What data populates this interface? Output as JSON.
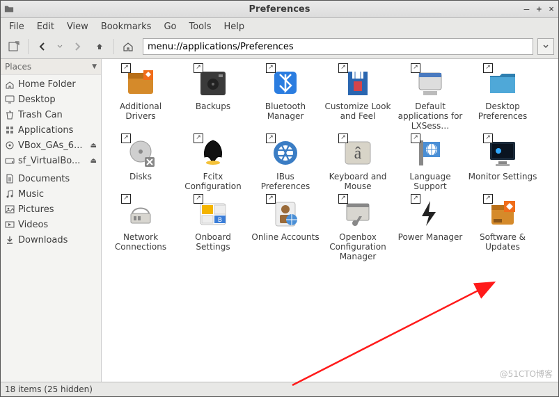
{
  "window": {
    "title": "Preferences"
  },
  "menus": [
    "File",
    "Edit",
    "View",
    "Bookmarks",
    "Go",
    "Tools",
    "Help"
  ],
  "addressbar": {
    "value": "menu://applications/Preferences"
  },
  "sidebar": {
    "header": "Places",
    "items": [
      {
        "icon": "home",
        "label": "Home Folder"
      },
      {
        "icon": "desktop",
        "label": "Desktop"
      },
      {
        "icon": "trash",
        "label": "Trash Can"
      },
      {
        "icon": "apps",
        "label": "Applications"
      },
      {
        "icon": "disc",
        "label": "VBox_GAs_6...",
        "ejectable": true
      },
      {
        "icon": "drive",
        "label": "sf_VirtualBo...",
        "ejectable": true
      }
    ],
    "bookmarks": [
      {
        "icon": "docs",
        "label": "Documents"
      },
      {
        "icon": "music",
        "label": "Music"
      },
      {
        "icon": "pictures",
        "label": "Pictures"
      },
      {
        "icon": "videos",
        "label": "Videos"
      },
      {
        "icon": "downloads",
        "label": "Downloads"
      }
    ]
  },
  "items": [
    {
      "label": "Additional Drivers",
      "icon": "additional-drivers"
    },
    {
      "label": "Backups",
      "icon": "backups"
    },
    {
      "label": "Bluetooth Manager",
      "icon": "bluetooth"
    },
    {
      "label": "Customize Look and Feel",
      "icon": "look-feel"
    },
    {
      "label": "Default applications for LXSess…",
      "icon": "default-apps"
    },
    {
      "label": "Desktop Preferences",
      "icon": "desktop-prefs"
    },
    {
      "label": "Disks",
      "icon": "disks"
    },
    {
      "label": "Fcitx Configuration",
      "icon": "fcitx"
    },
    {
      "label": "IBus Preferences",
      "icon": "ibus"
    },
    {
      "label": "Keyboard and Mouse",
      "icon": "keyboard"
    },
    {
      "label": "Language Support",
      "icon": "language"
    },
    {
      "label": "Monitor Settings",
      "icon": "monitor"
    },
    {
      "label": "Network Connections",
      "icon": "network"
    },
    {
      "label": "Onboard Settings",
      "icon": "onboard"
    },
    {
      "label": "Online Accounts",
      "icon": "online"
    },
    {
      "label": "Openbox Configuration Manager",
      "icon": "openbox"
    },
    {
      "label": "Power Manager",
      "icon": "power"
    },
    {
      "label": "Software & Updates",
      "icon": "software"
    }
  ],
  "status": "18 items (25 hidden)",
  "watermark": "@51CTO博客"
}
